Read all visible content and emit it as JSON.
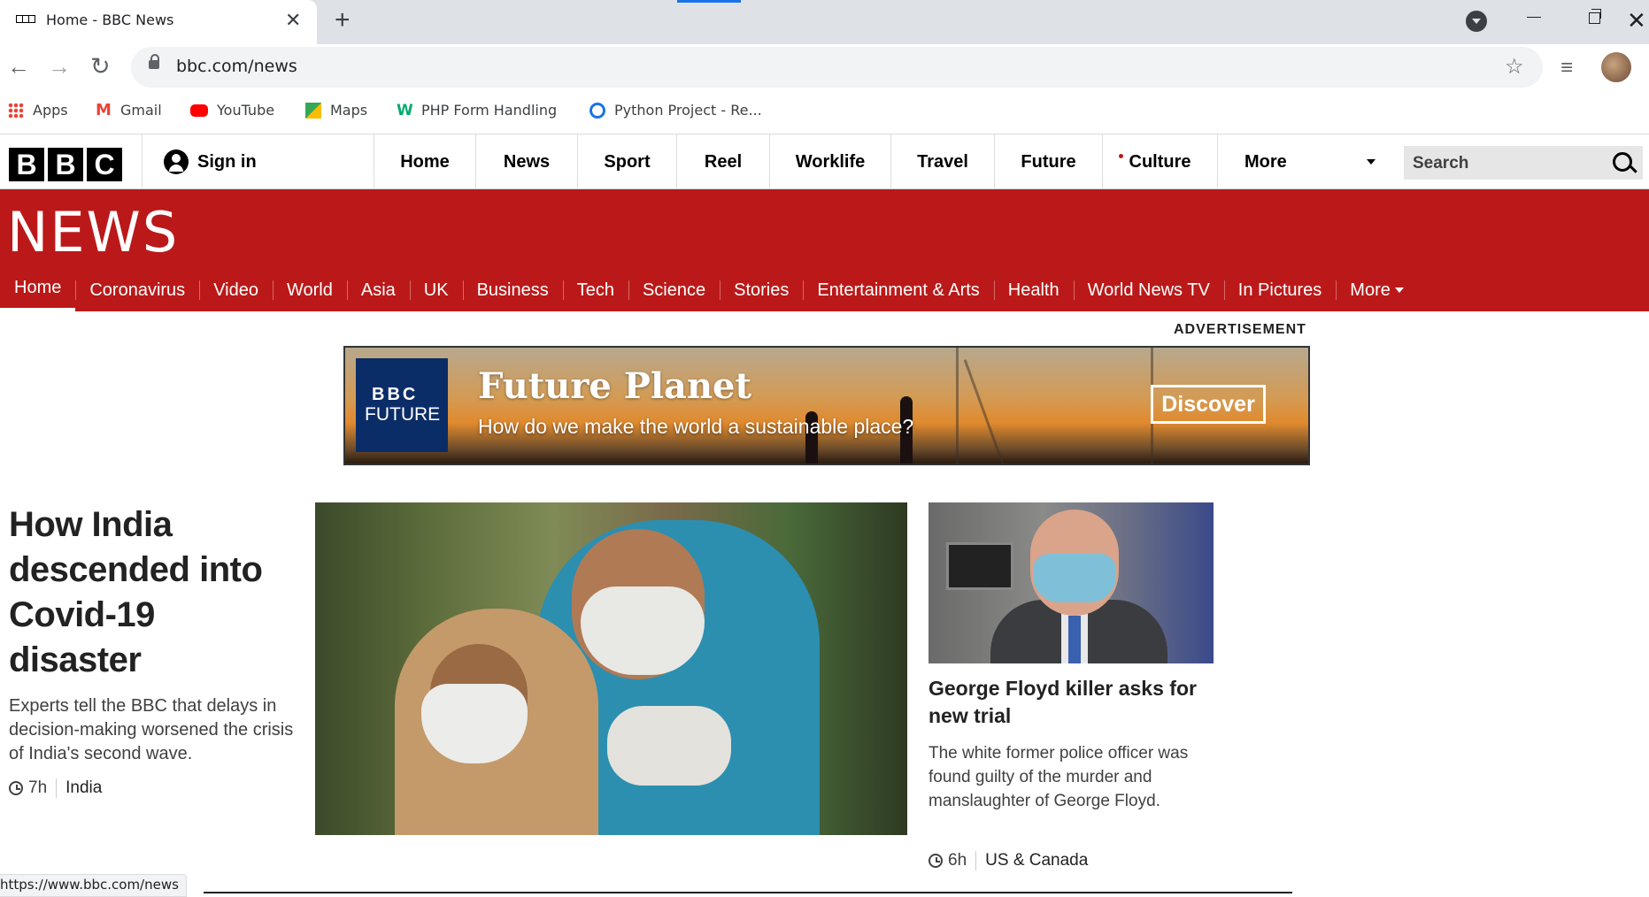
{
  "browser": {
    "tab_title": "Home - BBC News",
    "tab_close": "✕",
    "new_tab": "+",
    "url": "bbc.com/news",
    "bookmarks": [
      {
        "label": "Apps"
      },
      {
        "label": "Gmail"
      },
      {
        "label": "YouTube"
      },
      {
        "label": "Maps"
      },
      {
        "label": "PHP Form Handling"
      },
      {
        "label": "Python Project - Re..."
      }
    ],
    "status_url": "https://www.bbc.com/news"
  },
  "bbc": {
    "logo_letters": [
      "B",
      "B",
      "C"
    ],
    "sign_in": "Sign in",
    "top_nav": [
      "Home",
      "News",
      "Sport",
      "Reel",
      "Worklife",
      "Travel",
      "Future",
      "Culture",
      "More"
    ],
    "search_label": "Search",
    "section_title": "NEWS",
    "sub_nav": [
      "Home",
      "Coronavirus",
      "Video",
      "World",
      "Asia",
      "UK",
      "Business",
      "Tech",
      "Science",
      "Stories",
      "Entertainment & Arts",
      "Health",
      "World News TV",
      "In Pictures",
      "More"
    ],
    "active_sub_nav": "Home",
    "accent_color": "#bb1919"
  },
  "advertisement": {
    "label": "ADVERTISEMENT",
    "logo_top": "BBC",
    "logo_bottom": "FUTURE",
    "title": "Future Planet",
    "subtitle": "How do we make the world a sustainable place?",
    "cta": "Discover"
  },
  "lead_story": {
    "headline": "How India descended into Covid-19 disaster",
    "summary": "Experts tell the BBC that delays in decision-making worsened the crisis of India's second wave.",
    "time": "7h",
    "tag": "India"
  },
  "side_story": {
    "headline": "George Floyd killer asks for new trial",
    "summary": "The white former police officer was found guilty of the murder and manslaughter of George Floyd.",
    "time": "6h",
    "tag": "US & Canada"
  }
}
